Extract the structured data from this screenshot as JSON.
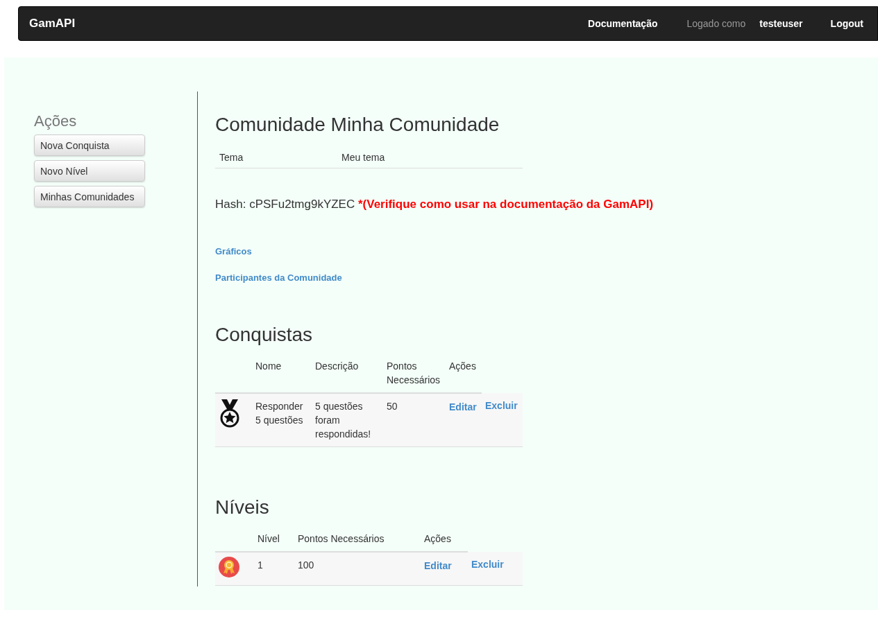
{
  "navbar": {
    "brand": "GamAPI",
    "links": [
      {
        "label": "Documentação",
        "kind": "link"
      },
      {
        "label": "Logado como",
        "kind": "text"
      },
      {
        "label": "testeuser",
        "kind": "link"
      },
      {
        "label": "Logout",
        "kind": "link"
      }
    ]
  },
  "sidebar": {
    "title": "Ações",
    "buttons": [
      "Nova Conquista",
      "Novo Nível",
      "Minhas Comunidades"
    ]
  },
  "community": {
    "title": "Comunidade Minha Comunidade",
    "theme_label": "Tema",
    "theme_value": "Meu tema",
    "hash_label": "Hash: cPSFu2tmg9kYZEC",
    "hash_note": "*(Verifique como usar na documentação da GamAPI)",
    "links": [
      "Gráficos",
      "Participantes da Comunidade"
    ]
  },
  "achievements": {
    "title": "Conquistas",
    "columns": [
      "Nome",
      "Descrição",
      "Pontos Necessários",
      "Ações"
    ],
    "rows": [
      {
        "name": "Responder 5 questões",
        "description": "5 questões foram respondidas!",
        "points": "50",
        "actions": [
          "Editar",
          "Excluir"
        ]
      }
    ]
  },
  "levels": {
    "title": "Níveis",
    "columns": [
      "Nível",
      "Pontos Necessários",
      "Ações"
    ],
    "rows": [
      {
        "level": "1",
        "points": "100",
        "actions": [
          "Editar",
          "Excluir"
        ]
      }
    ]
  }
}
